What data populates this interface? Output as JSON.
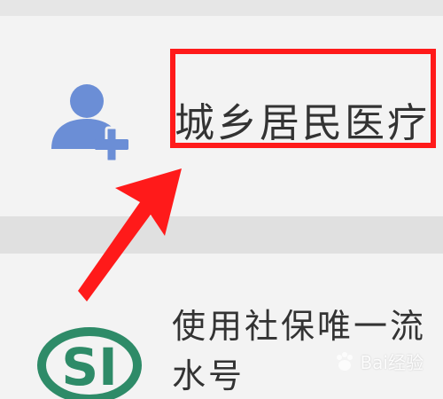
{
  "list": {
    "items": [
      {
        "title": "城乡居民医疗",
        "icon": "user-add-icon"
      },
      {
        "title": "使用社保唯一流水号",
        "icon": "social-security-logo-icon"
      }
    ]
  },
  "annotation": {
    "highlight_color": "#ff1a1a",
    "arrow_color": "#ff1a1a"
  },
  "colors": {
    "icon_blue": "#6b8ed6",
    "logo_green": "#2e8b68",
    "text": "#333333"
  },
  "watermark": {
    "text": "Bai经验",
    "icon": "baidu-paw-icon"
  }
}
